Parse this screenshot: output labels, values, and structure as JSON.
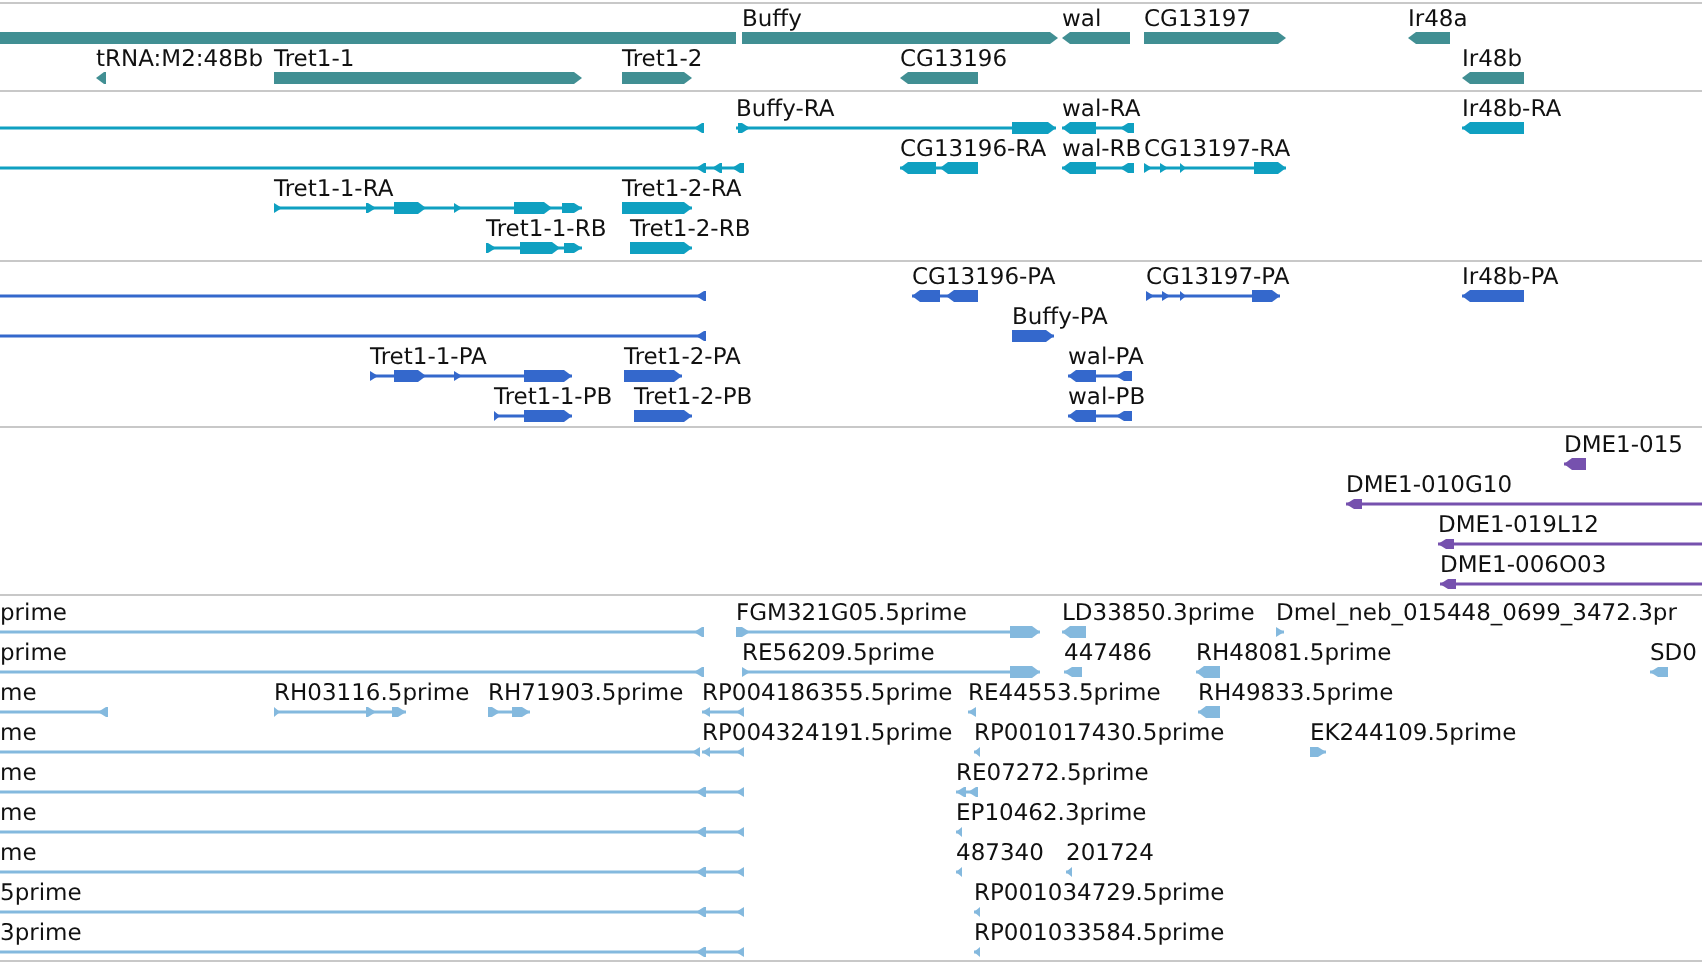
{
  "tracks": [
    {
      "kind": "gene",
      "color": "#418f93",
      "rows": [
        {
          "features": [
            {
              "forward": false
            },
            {
              "label": "Buffy",
              "forward": true
            },
            {
              "label": "wal",
              "forward": false
            },
            {
              "label": "CG13197",
              "forward": true
            },
            {
              "label": "Ir48a",
              "forward": false
            }
          ]
        },
        {
          "features": [
            {
              "label": "tRNA:M2:48Bb",
              "forward": false
            },
            {
              "label": "Tret1-1",
              "forward": true
            },
            {
              "label": "Tret1-2",
              "forward": true
            },
            {
              "label": "CG13196",
              "forward": false
            },
            {
              "label": "Ir48b",
              "forward": false
            }
          ]
        }
      ]
    },
    {
      "kind": "transcript",
      "color": "#0fa0c1",
      "rows": [
        {
          "features": [
            {
              "forward": false
            },
            {
              "label": "Buffy-RA",
              "forward": true
            },
            {
              "label": "wal-RA",
              "forward": false
            },
            {
              "label": "Ir48b-RA",
              "forward": false
            }
          ]
        },
        {
          "features": [
            {
              "forward": false
            },
            {
              "label": "CG13196-RA",
              "forward": false
            },
            {
              "label": "wal-RB",
              "forward": false
            },
            {
              "label": "CG13197-RA",
              "forward": true
            }
          ]
        },
        {
          "features": [
            {
              "label": "Tret1-1-RA",
              "forward": true
            },
            {
              "label": "Tret1-2-RA",
              "forward": true
            }
          ]
        },
        {
          "features": [
            {
              "label": "Tret1-1-RB",
              "forward": true
            },
            {
              "label": "Tret1-2-RB",
              "forward": true
            }
          ]
        }
      ]
    },
    {
      "kind": "transcript",
      "color": "#3468cc",
      "rows": [
        {
          "features": [
            {
              "forward": false
            },
            {
              "label": "CG13196-PA",
              "forward": false
            },
            {
              "label": "CG13197-PA",
              "forward": true
            },
            {
              "label": "Ir48b-PA",
              "forward": false
            }
          ]
        },
        {
          "features": [
            {
              "forward": false
            },
            {
              "label": "Buffy-PA",
              "forward": true
            }
          ]
        },
        {
          "features": [
            {
              "label": "Tret1-1-PA",
              "forward": true
            },
            {
              "label": "Tret1-2-PA",
              "forward": true
            },
            {
              "label": "wal-PA",
              "forward": false
            }
          ]
        },
        {
          "features": [
            {
              "label": "Tret1-1-PB",
              "forward": true
            },
            {
              "label": "Tret1-2-PB",
              "forward": true
            },
            {
              "label": "wal-PB",
              "forward": false
            }
          ]
        }
      ]
    },
    {
      "kind": "transcript",
      "color": "#7651ae",
      "rows": [
        {
          "features": [
            {
              "label": "DME1-015",
              "forward": false
            }
          ]
        },
        {
          "features": [
            {
              "label": "DME1-010G10",
              "forward": false
            }
          ]
        },
        {
          "features": [
            {
              "label": "DME1-019L12",
              "forward": false
            }
          ]
        },
        {
          "features": [
            {
              "label": "DME1-006O03",
              "forward": false
            }
          ]
        }
      ]
    },
    {
      "kind": "transcript",
      "color": "#84b9de",
      "rows": [
        {
          "features": [
            {
              "label": "prime",
              "forward": false
            },
            {
              "label": "FGM321G05.5prime",
              "forward": true
            },
            {
              "label": "LD33850.3prime",
              "forward": false
            },
            {
              "label": "Dmel_neb_015448_0699_3472.3pr",
              "forward": true
            }
          ]
        },
        {
          "features": [
            {
              "label": "prime",
              "forward": false
            },
            {
              "label": "RE56209.5prime",
              "forward": true
            },
            {
              "label": "447486",
              "forward": false
            },
            {
              "label": "RH48081.5prime",
              "forward": false
            },
            {
              "label": "SD0",
              "forward": false
            }
          ]
        },
        {
          "features": [
            {
              "label": "me",
              "forward": false
            },
            {
              "label": "RH03116.5prime",
              "forward": true
            },
            {
              "label": "RH71903.5prime",
              "forward": true
            },
            {
              "label": "RP004186355.5prime",
              "forward": false
            },
            {
              "label": "RE44553.5prime",
              "forward": false
            },
            {
              "label": "RH49833.5prime",
              "forward": false
            }
          ]
        },
        {
          "features": [
            {
              "label": "me",
              "forward": false
            },
            {
              "label": "RP004324191.5prime",
              "forward": false
            },
            {
              "label": "RP001017430.5prime",
              "forward": false
            },
            {
              "label": "EK244109.5prime",
              "forward": true
            }
          ]
        },
        {
          "features": [
            {
              "label": "me",
              "forward": false
            },
            {
              "label": "RE07272.5prime",
              "forward": false
            }
          ]
        },
        {
          "features": [
            {
              "label": "me",
              "forward": false
            },
            {
              "label": "EP10462.3prime",
              "forward": false
            }
          ]
        },
        {
          "features": [
            {
              "label": "me",
              "forward": false
            },
            {
              "label": "487340",
              "forward": false
            },
            {
              "label": "201724",
              "forward": false
            }
          ]
        },
        {
          "features": [
            {
              "label": "5prime",
              "forward": false
            },
            {
              "label": "RP001034729.5prime",
              "forward": false
            }
          ]
        },
        {
          "features": [
            {
              "label": "3prime",
              "forward": false
            },
            {
              "label": "RP001033584.5prime",
              "forward": false
            }
          ]
        }
      ]
    }
  ]
}
